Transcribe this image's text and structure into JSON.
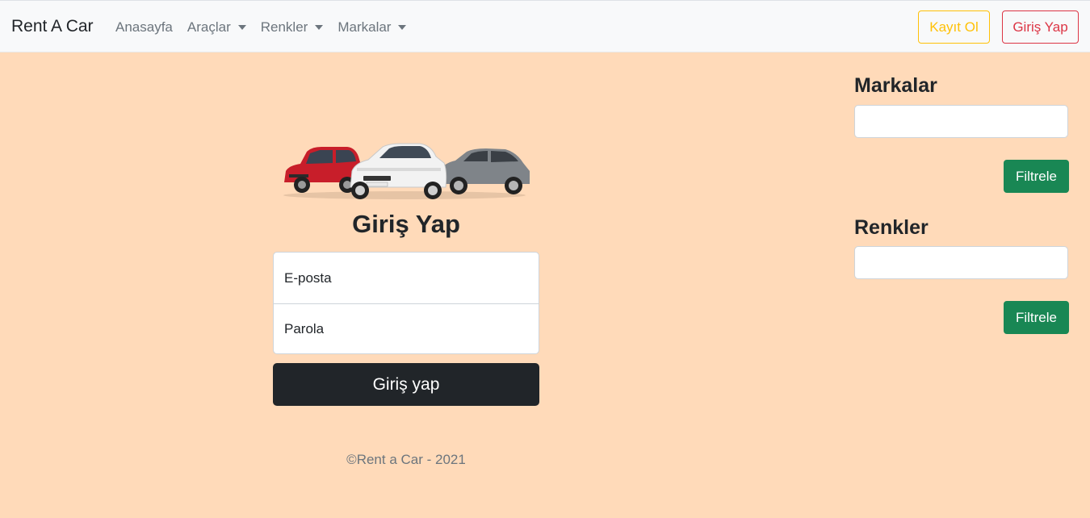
{
  "navbar": {
    "brand": "Rent A Car",
    "links": [
      {
        "label": "Anasayfa",
        "dropdown": false
      },
      {
        "label": "Araçlar",
        "dropdown": true
      },
      {
        "label": "Renkler",
        "dropdown": true
      },
      {
        "label": "Markalar",
        "dropdown": true
      }
    ],
    "register_label": "Kayıt Ol",
    "login_label": "Giriş Yap"
  },
  "login": {
    "title": "Giriş Yap",
    "email_placeholder": "E-posta",
    "password_placeholder": "Parola",
    "submit_label": "Giriş yap"
  },
  "footer": {
    "text": "©Rent a Car - 2021"
  },
  "sidebar": {
    "brands_heading": "Markalar",
    "brands_value": "",
    "brands_filter_label": "Filtrele",
    "colors_heading": "Renkler",
    "colors_value": "",
    "colors_filter_label": "Filtrele"
  },
  "colors": {
    "background": "#ffdab9",
    "navbar": "#f8f9fa",
    "register_outline": "#ffc107",
    "login_outline": "#dc3545",
    "submit": "#212529",
    "filter": "#198754"
  }
}
